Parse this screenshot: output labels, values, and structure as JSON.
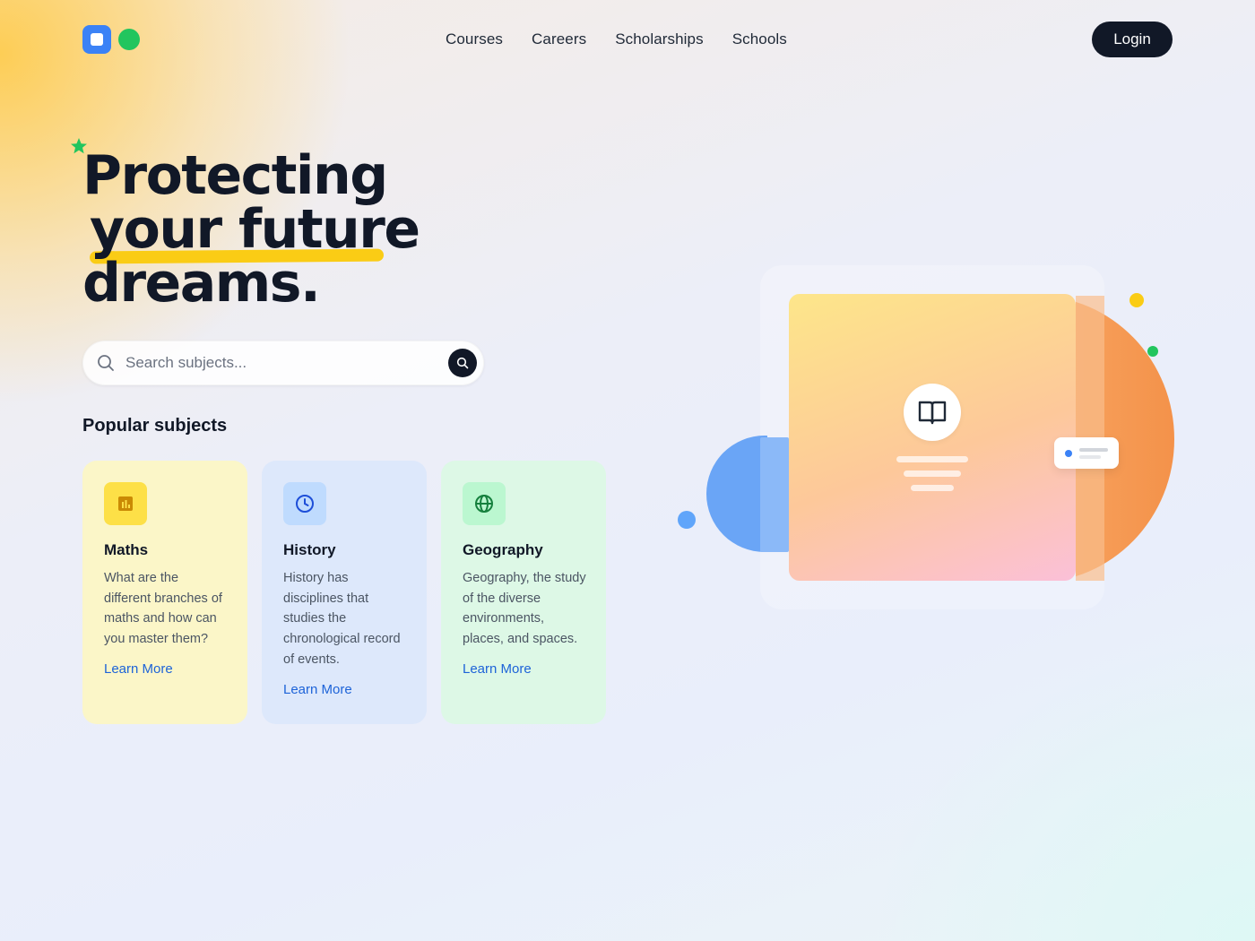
{
  "nav": {
    "links": [
      "Courses",
      "Careers",
      "Scholarships",
      "Schools"
    ],
    "login_label": "Login"
  },
  "hero": {
    "line1": "Protecting",
    "line2": "your future",
    "line3": "dreams."
  },
  "search": {
    "placeholder": "Search subjects..."
  },
  "section_title": "Popular subjects",
  "subjects": [
    {
      "title": "Maths",
      "description": "What are the different branches of maths and how can you master them?",
      "link": "Learn More",
      "icon": "bar-chart-icon"
    },
    {
      "title": "History",
      "description": "History has disciplines that studies the chronological record of events.",
      "link": "Learn More",
      "icon": "clock-icon"
    },
    {
      "title": "Geography",
      "description": "Geography, the study of the diverse environments, places, and spaces.",
      "link": "Learn More",
      "icon": "globe-icon"
    }
  ],
  "colors": {
    "brand_blue": "#3b82f6",
    "brand_green": "#22c55e",
    "accent_yellow": "#facc15",
    "dark": "#111827",
    "link_blue": "#1d63d8"
  }
}
